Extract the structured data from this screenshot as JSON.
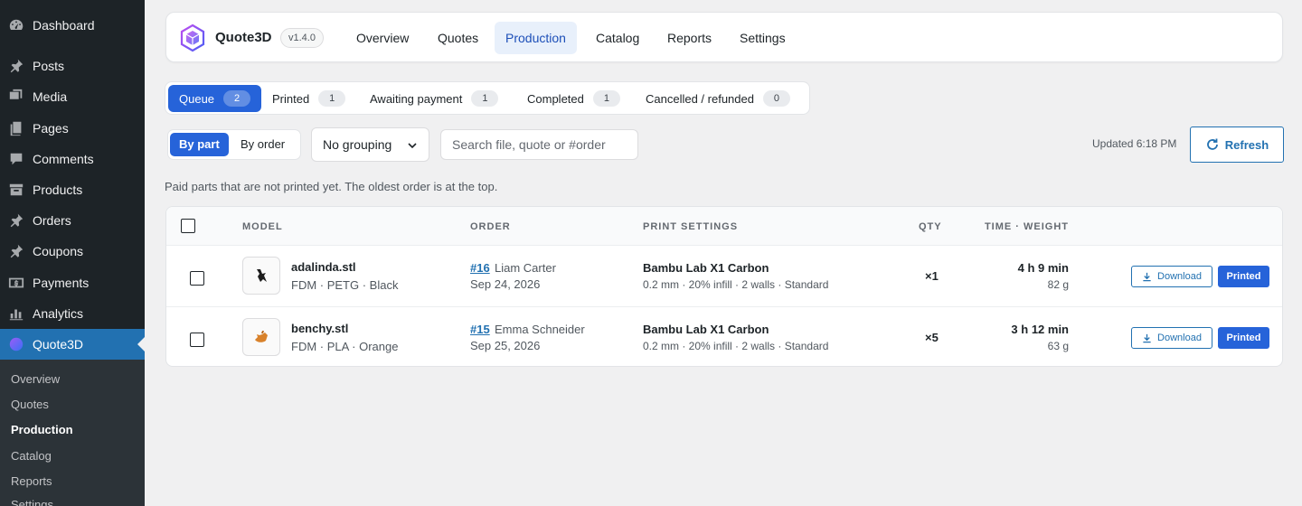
{
  "sidebar": {
    "items": [
      {
        "label": "Dashboard",
        "icon": "dashboard-icon"
      },
      {
        "label": "Posts",
        "icon": "pin-icon"
      },
      {
        "label": "Media",
        "icon": "media-icon"
      },
      {
        "label": "Pages",
        "icon": "pages-icon"
      },
      {
        "label": "Comments",
        "icon": "comment-icon"
      },
      {
        "label": "Products",
        "icon": "archive-icon"
      },
      {
        "label": "Orders",
        "icon": "pin-icon"
      },
      {
        "label": "Coupons",
        "icon": "pin-icon"
      },
      {
        "label": "Payments",
        "icon": "dollar-icon"
      },
      {
        "label": "Analytics",
        "icon": "bar-chart-icon"
      },
      {
        "label": "Quote3D",
        "icon": "quote3d-icon"
      }
    ],
    "submenu": [
      "Overview",
      "Quotes",
      "Production",
      "Catalog",
      "Reports",
      "Settings"
    ]
  },
  "topbar": {
    "brand": "Quote3D",
    "version": "v1.4.0",
    "nav": [
      "Overview",
      "Quotes",
      "Production",
      "Catalog",
      "Reports",
      "Settings"
    ]
  },
  "status_tabs": [
    {
      "label": "Queue",
      "count": "2"
    },
    {
      "label": "Printed",
      "count": "1"
    },
    {
      "label": "Awaiting payment",
      "count": "1"
    },
    {
      "label": "Completed",
      "count": "1"
    },
    {
      "label": "Cancelled / refunded",
      "count": "0"
    }
  ],
  "toolbar": {
    "view_by_part": "By part",
    "view_by_order": "By order",
    "grouping": "No grouping",
    "search_placeholder": "Search file, quote or #order",
    "updated": "Updated 6:18 PM",
    "refresh": "Refresh"
  },
  "hint": "Paid parts that are not printed yet. The oldest order is at the top.",
  "table": {
    "headers": {
      "model": "MODEL",
      "order": "ORDER",
      "print_settings": "PRINT SETTINGS",
      "qty": "QTY",
      "time_weight": "TIME · WEIGHT"
    },
    "rows": [
      {
        "file": "adalinda.stl",
        "material": "FDM · PETG · Black",
        "order_no": "#16",
        "customer": "Liam Carter",
        "date": "Sep 24, 2026",
        "printer": "Bambu Lab X1 Carbon",
        "settings": "0.2 mm · 20% infill · 2 walls · Standard",
        "qty": "×1",
        "time": "4 h 9 min",
        "weight": "82 g",
        "download": "Download",
        "printed": "Printed",
        "thumb_color": "#1d1d1d"
      },
      {
        "file": "benchy.stl",
        "material": "FDM · PLA · Orange",
        "order_no": "#15",
        "customer": "Emma Schneider",
        "date": "Sep 25, 2026",
        "printer": "Bambu Lab X1 Carbon",
        "settings": "0.2 mm · 20% infill · 2 walls · Standard",
        "qty": "×5",
        "time": "3 h 12 min",
        "weight": "63 g",
        "download": "Download",
        "printed": "Printed",
        "thumb_color": "#d9822b"
      }
    ]
  },
  "colors": {
    "accent": "#2663d9",
    "wp_blue": "#2271b1",
    "sidebar_bg": "#1d2327"
  }
}
